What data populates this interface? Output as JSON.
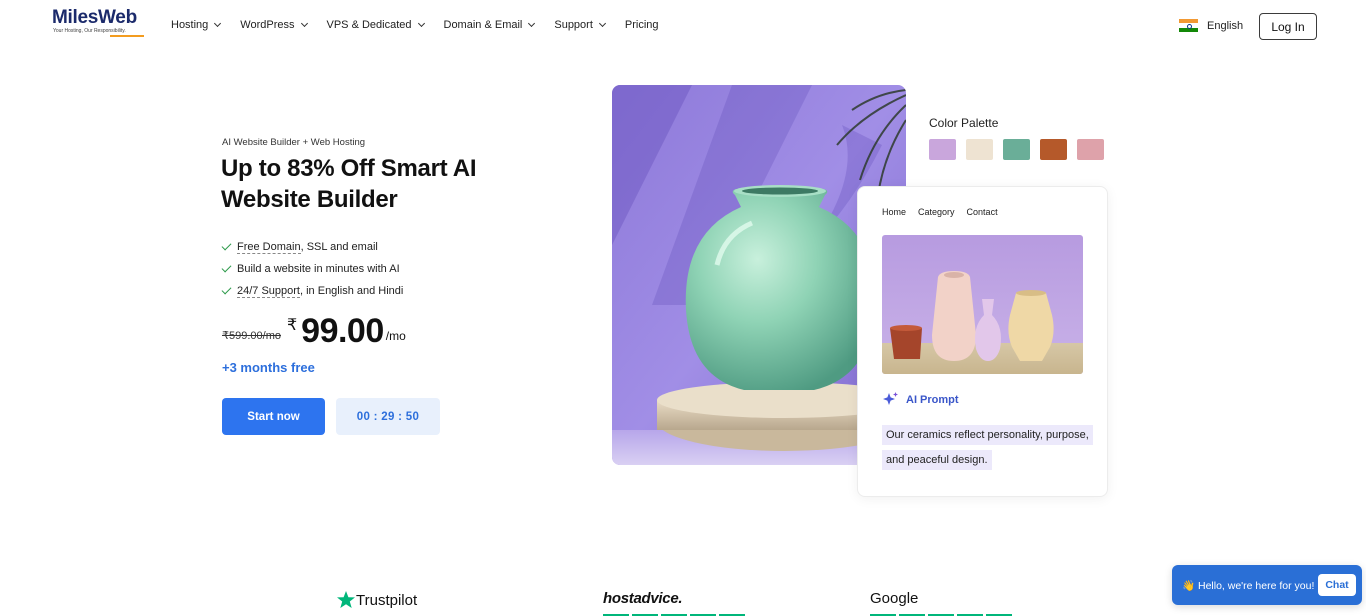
{
  "header": {
    "logo_text": "MilesWeb",
    "logo_tagline": "Your Hosting, Our Responsibility.",
    "nav": [
      {
        "label": "Hosting",
        "has_dropdown": true
      },
      {
        "label": "WordPress",
        "has_dropdown": true
      },
      {
        "label": "VPS & Dedicated",
        "has_dropdown": true
      },
      {
        "label": "Domain & Email",
        "has_dropdown": true
      },
      {
        "label": "Support",
        "has_dropdown": true
      },
      {
        "label": "Pricing",
        "has_dropdown": false
      }
    ],
    "language": "English",
    "login_label": "Log In"
  },
  "hero": {
    "eyebrow": "AI Website Builder + Web Hosting",
    "headline": "Up to 83% Off Smart AI Website Builder",
    "features": [
      {
        "linked": "Free Domain",
        "rest": ", SSL and email"
      },
      {
        "linked": "",
        "rest": "Build a website in minutes with AI"
      },
      {
        "linked": "24/7 Support",
        "rest": ", in English and Hindi"
      }
    ],
    "old_price": "₹599.00/mo",
    "currency": "₹",
    "price": "99.00",
    "per": "/mo",
    "bonus": "+3 months free",
    "cta_label": "Start now",
    "timer": "00 : 29 : 50"
  },
  "palette": {
    "title": "Color Palette",
    "colors": [
      "#c9a6dc",
      "#eee3d2",
      "#6aae98",
      "#b5592a",
      "#dea2aa"
    ]
  },
  "preview_card": {
    "nav": [
      "Home",
      "Category",
      "Contact"
    ],
    "ai_label": "AI Prompt",
    "prompt_lines": [
      "Our ceramics reflect personality, purpose,",
      "and peaceful design."
    ]
  },
  "reviews": {
    "trustpilot": "Trustpilot",
    "hostadvice": "hostadvice.",
    "google": "Google"
  },
  "chat": {
    "message": "👋 Hello, we're here for you!",
    "button": "Chat"
  },
  "colors": {
    "brand_blue": "#2d74ef",
    "accent_text_blue": "#2d6fdc",
    "check_green": "#2c9a4a",
    "lavender": "#9b86e0"
  }
}
